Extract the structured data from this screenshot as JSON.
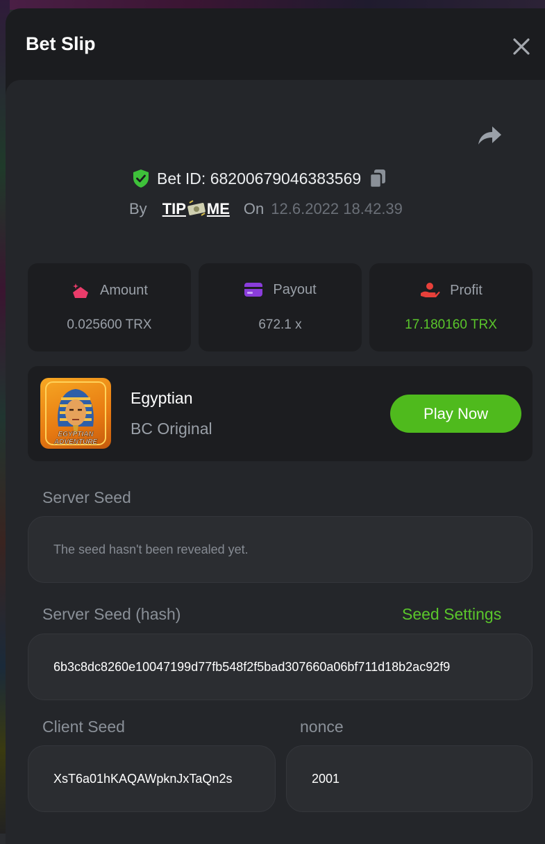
{
  "modal": {
    "title": "Bet Slip"
  },
  "bet": {
    "id_label": "Bet ID:",
    "id": "68200679046383569",
    "by_label": "By",
    "user_pre": "TIP",
    "user_post": "ME",
    "on_label": "On",
    "date": "12.6.2022 18.42.39"
  },
  "stats": [
    {
      "label": "Amount",
      "value": "0.025600 TRX",
      "icon": "amount-icon"
    },
    {
      "label": "Payout",
      "value": "672.1 x",
      "icon": "card-icon"
    },
    {
      "label": "Profit",
      "value": "17.180160 TRX",
      "icon": "profit-hand-icon"
    }
  ],
  "game": {
    "name": "Egyptian",
    "provider": "BC Original",
    "thumb_line1": "EGYPTIAN",
    "thumb_line2": "ADVENTURE",
    "play_label": "Play Now"
  },
  "seeds": {
    "server_label": "Server Seed",
    "server_value": "The seed hasn't been revealed yet.",
    "hash_label": "Server Seed (hash)",
    "settings_link": "Seed Settings",
    "hash_value": "6b3c8dc8260e10047199d77fb548f2f5bad307660a06bf711d18b2ac92f9",
    "client_label": "Client Seed",
    "client_value": "XsT6a01hKAQAWpknJxTaQn2s",
    "nonce_label": "nonce",
    "nonce_value": "2001"
  },
  "colors": {
    "accent_green": "#5ac62b",
    "button_green": "#4fba1d",
    "panel": "#1c1d20",
    "background": "#24262a"
  }
}
